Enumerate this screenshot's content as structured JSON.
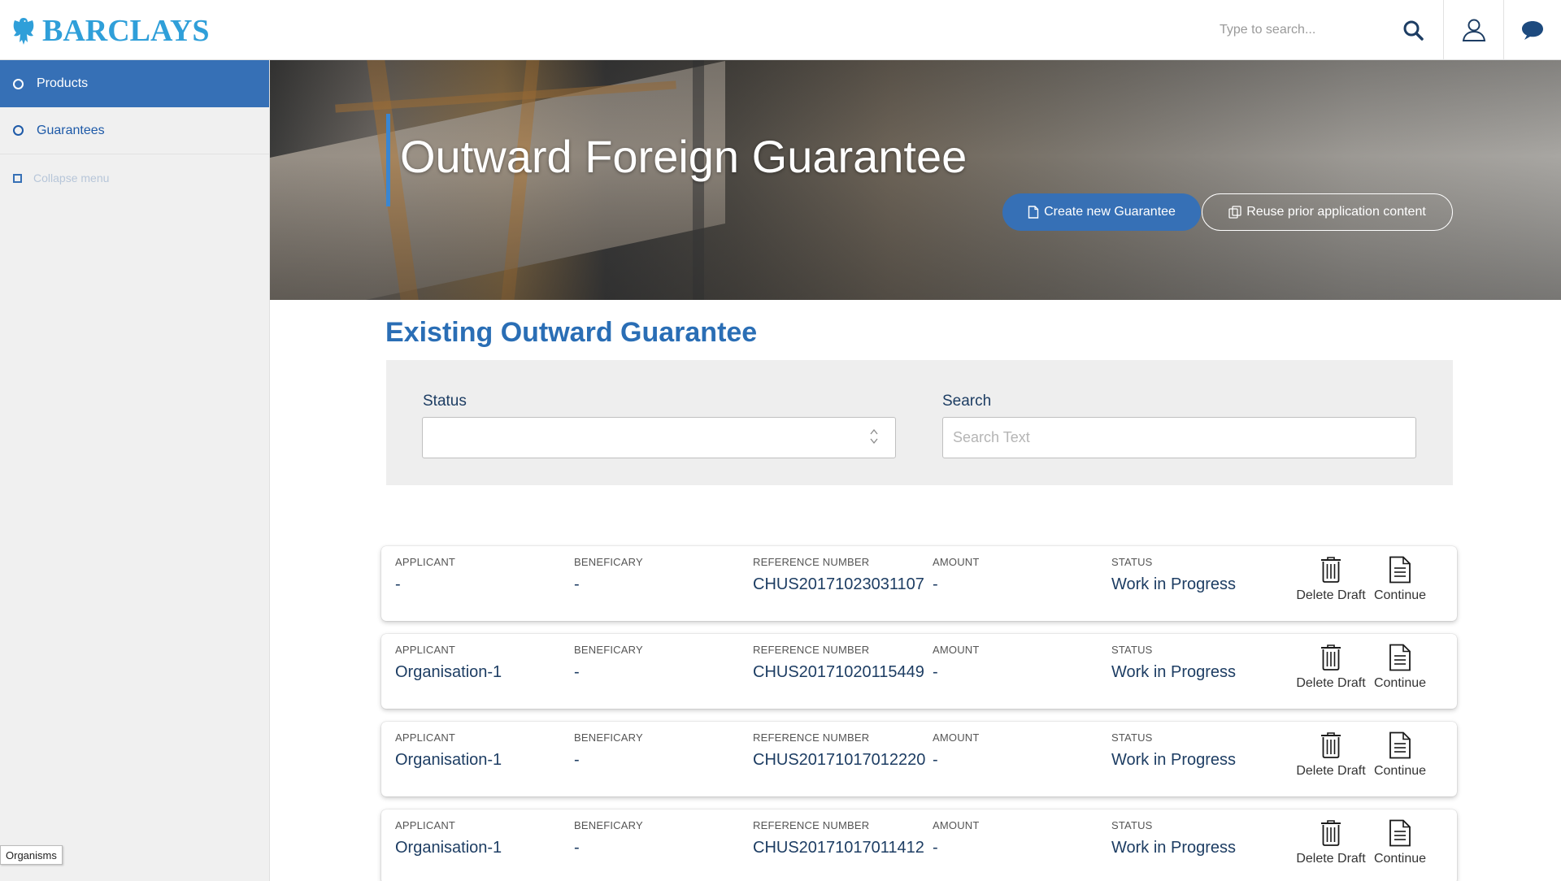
{
  "header": {
    "logo_text": "BARCLAYS",
    "search_placeholder": "Type to search...",
    "icons": [
      "search-icon",
      "user-icon",
      "chat-icon"
    ]
  },
  "sidebar": {
    "items": [
      {
        "label": "Products",
        "active": true
      },
      {
        "label": "Guarantees",
        "active": false
      }
    ],
    "collapse_label": "Collapse menu",
    "organisms_tag": "Organisms"
  },
  "hero": {
    "title": "Outward Foreign Guarantee",
    "create_button": "Create new Guarantee",
    "reuse_button": "Reuse prior application content"
  },
  "main": {
    "section_title": "Existing Outward Guarantee",
    "filters": {
      "status_label": "Status",
      "status_value": "",
      "search_label": "Search",
      "search_placeholder": "Search Text"
    },
    "column_headers": {
      "applicant": "APPLICANT",
      "beneficiary": "BENEFICARY",
      "reference": "REFERENCE NUMBER",
      "amount": "AMOUNT",
      "status": "STATUS"
    },
    "actions": {
      "delete": "Delete Draft",
      "continue": "Continue"
    },
    "rows": [
      {
        "applicant": "-",
        "beneficiary": "-",
        "reference": "CHUS20171023031107",
        "amount": "-",
        "status": "Work in Progress"
      },
      {
        "applicant": "Organisation-1",
        "beneficiary": "-",
        "reference": "CHUS20171020115449",
        "amount": "-",
        "status": "Work in Progress"
      },
      {
        "applicant": "Organisation-1",
        "beneficiary": "-",
        "reference": "CHUS20171017012220",
        "amount": "-",
        "status": "Work in Progress"
      },
      {
        "applicant": "Organisation-1",
        "beneficiary": "-",
        "reference": "CHUS20171017011412",
        "amount": "-",
        "status": "Work in Progress"
      }
    ]
  },
  "colors": {
    "brand_blue": "#3670b6",
    "logo_blue": "#2f9fd9",
    "title_blue": "#2a6eb5",
    "text_navy": "#1d3d63"
  }
}
